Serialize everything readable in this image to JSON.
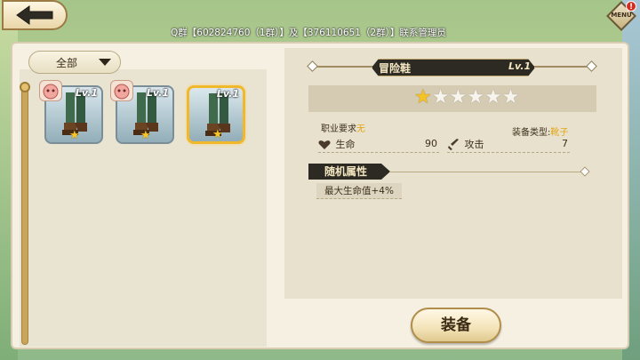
{
  "header": {
    "back_icon": "back-arrow-icon",
    "marquee": "Q群【602824760（1群）】及【376110651（2群）】联系管理员",
    "menu_label": "MENU",
    "menu_alert": "!"
  },
  "inventory": {
    "filter_label": "全部",
    "items": [
      {
        "level": "Lv.1",
        "star": "★",
        "selected": false
      },
      {
        "level": "Lv.1",
        "star": "★",
        "selected": false
      },
      {
        "level": "Lv.1",
        "star": "★",
        "selected": true
      }
    ]
  },
  "detail": {
    "name": "冒险鞋",
    "level": "Lv.1",
    "stars_total": 6,
    "stars_filled": 1,
    "requirement_label": "职业要求",
    "requirement_value": "无",
    "equip_type_label": "装备类型:",
    "equip_type_value": "靴子",
    "stats": [
      {
        "icon": "heart-icon",
        "label": "生命",
        "value": "90"
      },
      {
        "icon": "sword-icon",
        "label": "攻击",
        "value": "7"
      }
    ],
    "random_attr_title": "随机属性",
    "random_attrs": [
      "最大生命值+4%"
    ]
  },
  "actions": {
    "equip_label": "装备"
  },
  "colors": {
    "accent_gold": "#f0b82a",
    "highlight_text": "#e3a615",
    "dark_banner": "#2d2a24"
  }
}
